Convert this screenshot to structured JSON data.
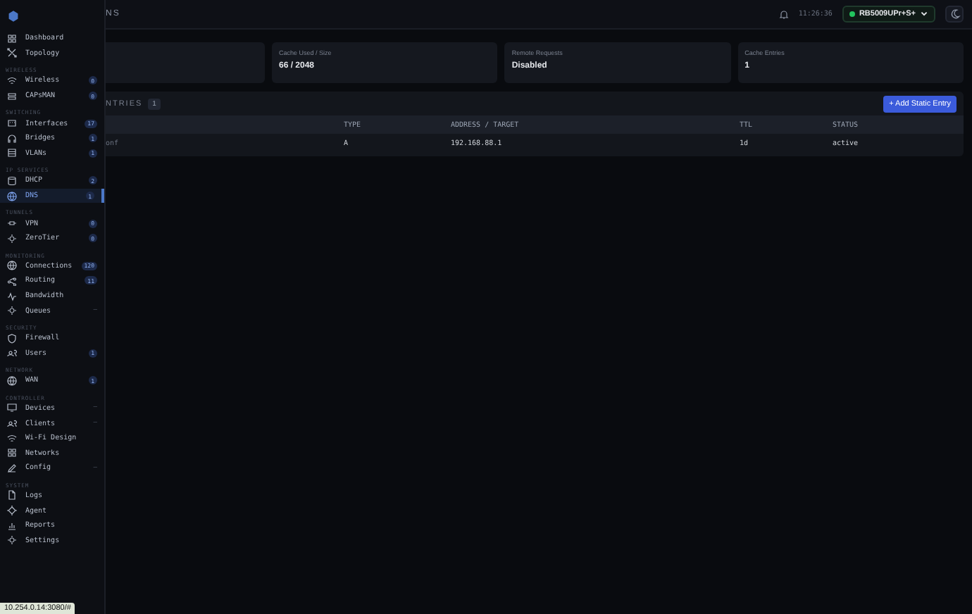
{
  "header": {
    "title": "NS",
    "time": "11:26:36",
    "device": {
      "label": "RB5009UPr+S+",
      "online": true
    }
  },
  "cards": [
    {
      "label": "Cache Used / Size",
      "value": "66 / 2048"
    },
    {
      "label": "Remote Requests",
      "value": "Disabled"
    },
    {
      "label": "Cache Entries",
      "value": "1"
    }
  ],
  "panel": {
    "title": "NTRIES",
    "count": "1",
    "button": "+ Add Static Entry",
    "table": {
      "columns": [
        null,
        "TYPE",
        "ADDRESS / TARGET",
        "TTL",
        "STATUS"
      ],
      "rows": [
        [
          "onf",
          "A",
          "192.168.88.1",
          "1d",
          "active"
        ]
      ]
    }
  },
  "sidebar": {
    "sections": [
      {
        "items": [
          {
            "label": "Dashboard",
            "selected": false
          },
          {
            "label": "Topology",
            "selected": false
          }
        ]
      },
      {
        "label": "WIRELESS",
        "items": [
          {
            "label": "Wireless",
            "count": "0",
            "selected": false
          },
          {
            "label": "CAPsMAN",
            "count": "0",
            "selected": false
          }
        ]
      },
      {
        "label": "SWITCHING",
        "items": [
          {
            "label": "Interfaces",
            "count": "17",
            "selected": false
          },
          {
            "label": "Bridges",
            "count": "1",
            "selected": false
          },
          {
            "label": "VLANs",
            "count": "1",
            "selected": false
          }
        ]
      },
      {
        "label": "IP SERVICES",
        "items": [
          {
            "label": "DHCP",
            "count": "2",
            "selected": false
          },
          {
            "label": "DNS",
            "count": "1",
            "selected": true
          }
        ]
      },
      {
        "label": "TUNNELS",
        "items": [
          {
            "label": "VPN",
            "count": "0",
            "selected": false
          },
          {
            "label": "ZeroTier",
            "count": "0",
            "selected": false
          }
        ]
      },
      {
        "label": "MONITORING",
        "items": [
          {
            "label": "Connections",
            "count": "120",
            "selected": false
          },
          {
            "label": "Routing",
            "count": "11",
            "selected": false
          },
          {
            "label": "Bandwidth",
            "selected": false
          },
          {
            "label": "Queues",
            "note": "—",
            "selected": false
          }
        ]
      },
      {
        "label": "SECURITY",
        "items": [
          {
            "label": "Firewall",
            "selected": false
          },
          {
            "label": "Users",
            "count": "1",
            "selected": false
          }
        ]
      },
      {
        "label": "NETWORK",
        "items": [
          {
            "label": "WAN",
            "count": "1",
            "selected": false
          }
        ]
      },
      {
        "label": "CONTROLLER",
        "items": [
          {
            "label": "Devices",
            "note": "—",
            "selected": false
          },
          {
            "label": "Clients",
            "note": "—",
            "selected": false
          },
          {
            "label": "Wi-Fi Design",
            "selected": false
          },
          {
            "label": "Networks",
            "selected": false
          },
          {
            "label": "Config",
            "note": "—",
            "selected": false
          }
        ]
      },
      {
        "label": "SYSTEM",
        "items": [
          {
            "label": "Logs",
            "selected": false
          },
          {
            "label": "Agent",
            "selected": false
          },
          {
            "label": "Reports",
            "selected": false
          },
          {
            "label": "Settings",
            "selected": false
          }
        ]
      }
    ]
  },
  "status_bar": {
    "url": "10.254.0.14:3080/#"
  }
}
